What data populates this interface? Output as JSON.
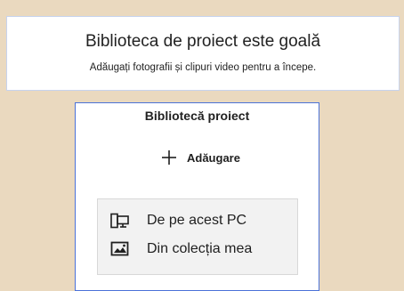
{
  "empty_state": {
    "title": "Biblioteca de proiect este goală",
    "subtitle": "Adăugați fotografii și clipuri video pentru a începe."
  },
  "library": {
    "title": "Bibliotecă proiect",
    "add_label": "Adăugare",
    "add_icon": "plus-icon",
    "menu_items": [
      {
        "label": "De pe acest PC",
        "icon": "computer-icon"
      },
      {
        "label": "Din colecția mea",
        "icon": "photos-collection-icon"
      }
    ]
  },
  "colors": {
    "page_background": "#ead9bf",
    "banner_border": "#c7d3ee",
    "panel_border": "#4b72d8",
    "menu_background": "#f2f2f2"
  }
}
